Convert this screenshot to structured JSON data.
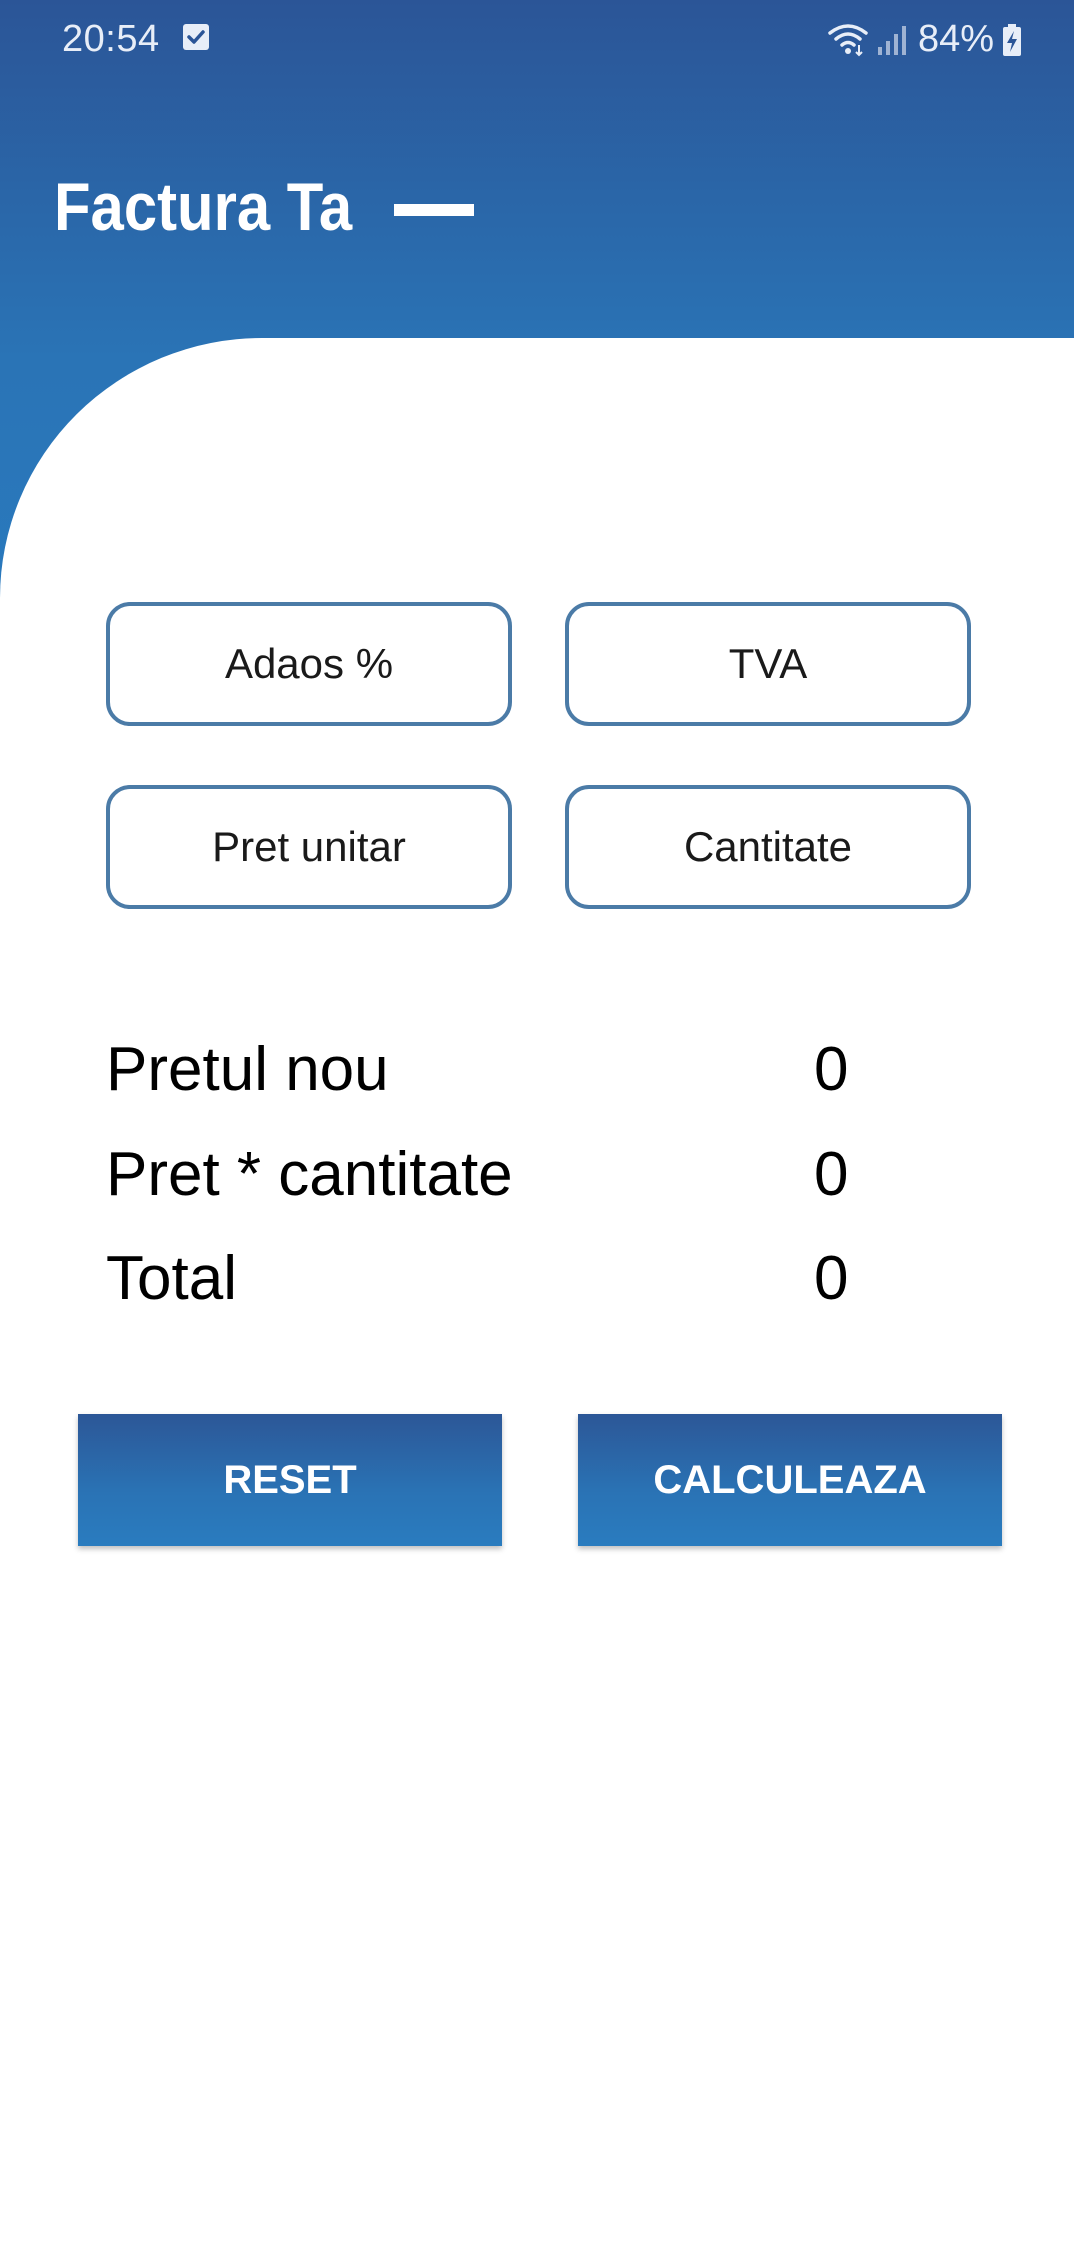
{
  "status_bar": {
    "time": "20:54",
    "battery": "84%",
    "check_icon": "check-box-icon",
    "wifi_icon": "wifi-icon",
    "signal_icon": "signal-icon",
    "battery_icon": "battery-charging-icon"
  },
  "header": {
    "title": "Factura Ta",
    "gradient_top": "#2b5597",
    "gradient_bottom": "#2979bd"
  },
  "inputs": {
    "adaos": {
      "placeholder": "Adaos %",
      "value": ""
    },
    "tva": {
      "placeholder": "TVA",
      "value": ""
    },
    "pret_unitar": {
      "placeholder": "Pret unitar",
      "value": ""
    },
    "cantitate": {
      "placeholder": "Cantitate",
      "value": ""
    },
    "border_color": "#4b7ba7"
  },
  "results": [
    {
      "label": "Pretul nou",
      "value": "0"
    },
    {
      "label": "Pret * cantitate",
      "value": "0"
    },
    {
      "label": "Total",
      "value": "0"
    }
  ],
  "buttons": {
    "reset_label": "RESET",
    "calculate_label": "CALCULEAZA"
  }
}
